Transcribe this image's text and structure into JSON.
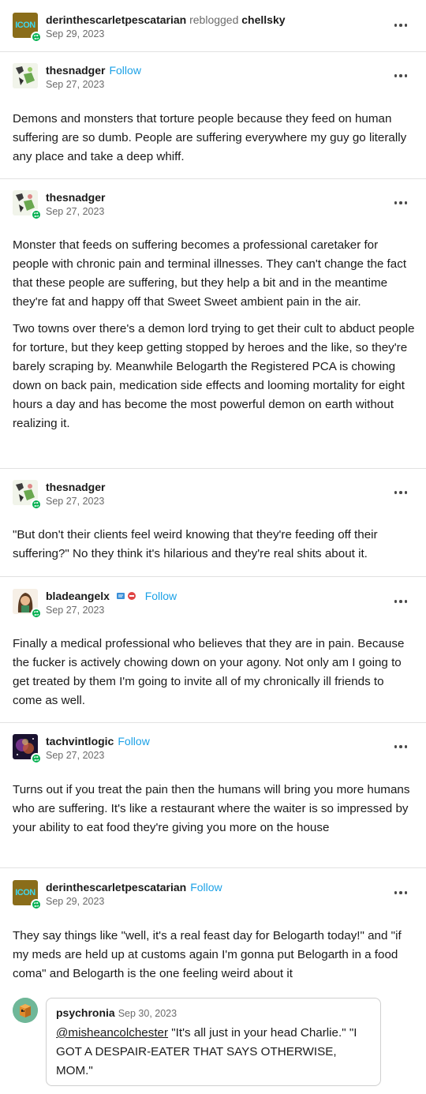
{
  "header_reblog": {
    "username": "derinthescarletpescatarian",
    "action": "reblogged",
    "source": "chellsky",
    "date": "Sep 29, 2023",
    "avatar_text": "ICON"
  },
  "posts": [
    {
      "username": "thesnadger",
      "follow_label": "Follow",
      "date": "Sep 27, 2023",
      "paragraphs": [
        "Demons and monsters that torture people because they feed on human suffering are so dumb. People are suffering everywhere my guy go literally any place and take a deep whiff."
      ]
    },
    {
      "username": "thesnadger",
      "date": "Sep 27, 2023",
      "paragraphs": [
        "Monster that feeds on suffering becomes a professional caretaker for people with chronic pain and terminal illnesses. They can't change the fact that these people are suffering, but they help a bit and in the meantime they're fat and happy off that Sweet Sweet ambient pain in the air.",
        "Two towns over there's a demon lord trying to get their cult to abduct people for torture, but they keep getting stopped by heroes and the like, so they're barely scraping by. Meanwhile Belogarth the Registered PCA is chowing down on back pain, medication side effects and looming mortality for eight hours a day and has become the most powerful demon on earth without realizing it."
      ]
    },
    {
      "username": "thesnadger",
      "date": "Sep 27, 2023",
      "paragraphs": [
        "\"But don't their clients feel weird knowing that they're feeding off their suffering?\" No they think it's hilarious and they're real shits about it."
      ]
    },
    {
      "username": "bladeangelx",
      "follow_label": "Follow",
      "date": "Sep 27, 2023",
      "paragraphs": [
        "Finally a medical professional who believes that they are in pain. Because the fucker is actively chowing down on your agony. Not only am I going to get treated by them I'm going to invite all of my chronically ill friends to come as well."
      ]
    },
    {
      "username": "tachvintlogic",
      "follow_label": "Follow",
      "date": "Sep 27, 2023",
      "paragraphs": [
        "Turns out if you treat the pain then the humans will bring you more humans who are suffering. It's like a restaurant where the waiter is so impressed by your ability to eat food they're giving you more on the house"
      ]
    },
    {
      "username": "derinthescarletpescatarian",
      "follow_label": "Follow",
      "date": "Sep 29, 2023",
      "avatar_text": "ICON",
      "paragraphs": [
        "They say things like \"well, it's a real feast day for Belogarth today!\" and \"if my meds are held up at customs again I'm gonna put Belogarth in a food coma\" and Belogarth is the one feeling weird about it"
      ]
    }
  ],
  "quote": {
    "username": "psychronia",
    "date": "Sep 30, 2023",
    "mention": "@misheancolchester",
    "text_after_mention": " \"It's all just in your head Charlie.\" \"I GOT A DESPAIR-EATER THAT SAYS OTHERWISE, MOM.\""
  },
  "colors": {
    "follow": "#1ca1e6",
    "reblog_badge": "#00b04f",
    "divider": "#e2e2e2"
  }
}
